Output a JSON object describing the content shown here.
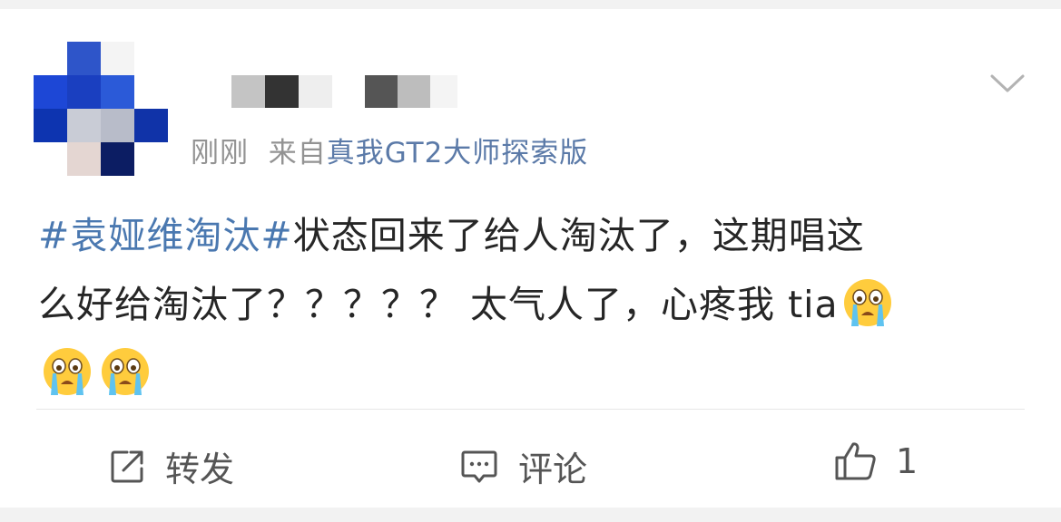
{
  "post": {
    "time": "刚刚",
    "source_prefix": "来自",
    "source_device": "真我GT2大师探索版",
    "topic": "#袁娅维淘汰#",
    "text_line1": "状态回来了给人淘汰了，这期唱这",
    "text_line2": "么好给淘汰了？？？？？ 太气人了，心疼我 tia"
  },
  "emojis": [
    "crying-emoji",
    "crying-emoji",
    "crying-emoji"
  ],
  "actions": {
    "forward_label": "转发",
    "comment_label": "评论",
    "like_count": "1"
  },
  "colors": {
    "topic": "#4a78b0",
    "source": "#5b7aa8",
    "meta": "#939393",
    "text": "#262626"
  }
}
